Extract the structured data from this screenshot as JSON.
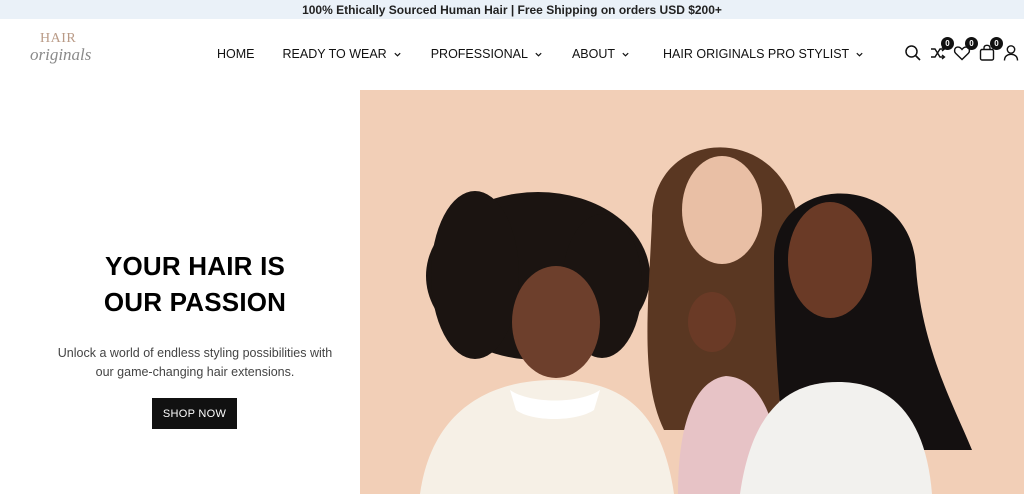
{
  "announcement": "100% Ethically Sourced Human Hair | Free Shipping on orders USD $200+",
  "logo": {
    "line1": "HAIR",
    "line2": "originals"
  },
  "nav": {
    "home": "HOME",
    "ready_to_wear": "READY TO WEAR",
    "professional": "PROFESSIONAL",
    "about": "ABOUT",
    "pro_stylist": "HAIR ORIGINALS PRO STYLIST"
  },
  "header_icons": {
    "search": "search-icon",
    "compare": {
      "icon": "compare-icon",
      "count": "0"
    },
    "wishlist": {
      "icon": "heart-icon",
      "count": "0"
    },
    "cart": {
      "icon": "bag-icon",
      "count": "0"
    },
    "account": "user-icon"
  },
  "hero": {
    "title_line1": "YOUR HAIR IS",
    "title_line2": "OUR PASSION",
    "text_line1": "Unlock a world of endless styling possibilities with",
    "text_line2": "our game-changing hair extensions.",
    "button": "SHOP NOW",
    "image_bg": "#f2cfb7"
  }
}
